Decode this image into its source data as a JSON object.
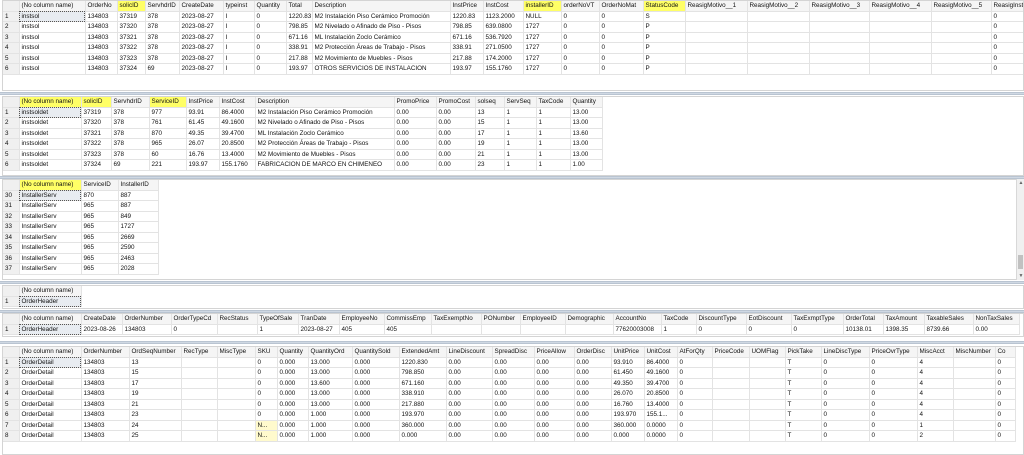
{
  "grids": [
    {
      "id": "g1",
      "columns": [
        {
          "label": "",
          "w": 16
        },
        {
          "label": "(No column name)",
          "w": 66
        },
        {
          "label": "OrderNo",
          "w": 32
        },
        {
          "label": "solicID",
          "w": 28,
          "highlight": true
        },
        {
          "label": "ServhdrID",
          "w": 34
        },
        {
          "label": "CreateDate",
          "w": 44
        },
        {
          "label": "typeinst",
          "w": 31
        },
        {
          "label": "Quantity",
          "w": 32
        },
        {
          "label": "Total",
          "w": 26
        },
        {
          "label": "Description",
          "w": 138
        },
        {
          "label": "InstPrice",
          "w": 33
        },
        {
          "label": "InstCost",
          "w": 40
        },
        {
          "label": "installerID",
          "w": 38,
          "highlight": true
        },
        {
          "label": "orderNoVT",
          "w": 38
        },
        {
          "label": "OrderNoMat",
          "w": 44
        },
        {
          "label": "StatusCode",
          "w": 42,
          "highlight": true
        },
        {
          "label": "ReasigMotivo__1",
          "w": 62
        },
        {
          "label": "ReasigMotivo__2",
          "w": 62
        },
        {
          "label": "ReasigMotivo__3",
          "w": 60
        },
        {
          "label": "ReasigMotivo__4",
          "w": 62
        },
        {
          "label": "ReasigMotivo__5",
          "w": 60
        },
        {
          "label": "ReasigInstal",
          "w": 40
        }
      ],
      "rows": [
        [
          "1",
          "instsol",
          "134803",
          "37319",
          "378",
          "2023-08-27",
          "I",
          "0",
          "1220.83",
          "M2 Instalación Piso Cerámico Promoción",
          "1220.83",
          "1123.2000",
          "NULL",
          "0",
          "0",
          "S",
          "",
          "",
          "",
          "",
          "",
          "0"
        ],
        [
          "2",
          "instsol",
          "134803",
          "37320",
          "378",
          "2023-08-27",
          "I",
          "0",
          "798.85",
          "M2 Nivelado o Afinado de Piso - Pisos",
          "798.85",
          "639.0800",
          "1727",
          "0",
          "0",
          "P",
          "",
          "",
          "",
          "",
          "",
          "0"
        ],
        [
          "3",
          "instsol",
          "134803",
          "37321",
          "378",
          "2023-08-27",
          "I",
          "0",
          "671.16",
          "ML Instalación Zoclo Cerámico",
          "671.16",
          "536.7920",
          "1727",
          "0",
          "0",
          "P",
          "",
          "",
          "",
          "",
          "",
          "0"
        ],
        [
          "4",
          "instsol",
          "134803",
          "37322",
          "378",
          "2023-08-27",
          "I",
          "0",
          "338.91",
          "M2 Protección Áreas de Trabajo - Pisos",
          "338.91",
          "271.0500",
          "1727",
          "0",
          "0",
          "P",
          "",
          "",
          "",
          "",
          "",
          "0"
        ],
        [
          "5",
          "instsol",
          "134803",
          "37323",
          "378",
          "2023-08-27",
          "I",
          "0",
          "217.88",
          "M2 Movimiento de Muebles - Pisos",
          "217.88",
          "174.2000",
          "1727",
          "0",
          "0",
          "P",
          "",
          "",
          "",
          "",
          "",
          "0"
        ],
        [
          "6",
          "instsol",
          "134803",
          "37324",
          "69",
          "2023-08-27",
          "I",
          "0",
          "193.97",
          "OTROS SERVICIOS DE INSTALACION",
          "193.97",
          "155.1760",
          "1727",
          "0",
          "0",
          "P",
          "",
          "",
          "",
          "",
          "",
          "0"
        ]
      ]
    },
    {
      "id": "g2",
      "columns": [
        {
          "label": "",
          "w": 16
        },
        {
          "label": "(No column name)",
          "w": 62,
          "highlight": true
        },
        {
          "label": "solicID",
          "w": 30,
          "highlight": true
        },
        {
          "label": "ServhdrID",
          "w": 38
        },
        {
          "label": "ServiceID",
          "w": 37,
          "highlight": true
        },
        {
          "label": "InstPrice",
          "w": 33
        },
        {
          "label": "InstCost",
          "w": 36
        },
        {
          "label": "Description",
          "w": 139
        },
        {
          "label": "PromoPrice",
          "w": 42
        },
        {
          "label": "PromoCost",
          "w": 39
        },
        {
          "label": "solseq",
          "w": 29
        },
        {
          "label": "ServSeq",
          "w": 32
        },
        {
          "label": "TaxCode",
          "w": 34
        },
        {
          "label": "Quantity",
          "w": 32
        }
      ],
      "rows": [
        [
          "1",
          "instsoldet",
          "37319",
          "378",
          "977",
          "93.91",
          "86.4000",
          "M2 Instalación Piso Cerámico Promoción",
          "0.00",
          "0.00",
          "13",
          "1",
          "1",
          "13.00"
        ],
        [
          "2",
          "instsoldet",
          "37320",
          "378",
          "761",
          "61.45",
          "49.1600",
          "M2 Nivelado o Afinado de Piso - Pisos",
          "0.00",
          "0.00",
          "15",
          "1",
          "1",
          "13.00"
        ],
        [
          "3",
          "instsoldet",
          "37321",
          "378",
          "870",
          "49.35",
          "39.4700",
          "ML Instalación Zoclo Cerámico",
          "0.00",
          "0.00",
          "17",
          "1",
          "1",
          "13.60"
        ],
        [
          "4",
          "instsoldet",
          "37322",
          "378",
          "965",
          "26.07",
          "20.8500",
          "M2 Protección Áreas de Trabajo - Pisos",
          "0.00",
          "0.00",
          "19",
          "1",
          "1",
          "13.00"
        ],
        [
          "5",
          "instsoldet",
          "37323",
          "378",
          "60",
          "16.76",
          "13.4000",
          "M2 Movimiento de Muebles - Pisos",
          "0.00",
          "0.00",
          "21",
          "1",
          "1",
          "13.00"
        ],
        [
          "6",
          "instsoldet",
          "37324",
          "69",
          "221",
          "193.97",
          "155.1760",
          "FABRICACION DE MARCO  EN CHIMENEO",
          "0.00",
          "0.00",
          "23",
          "1",
          "1",
          "1.00"
        ]
      ]
    },
    {
      "id": "g3",
      "columns": [
        {
          "label": "",
          "w": 16
        },
        {
          "label": "(No column name)",
          "w": 62,
          "highlight": true
        },
        {
          "label": "ServiceID",
          "w": 37
        },
        {
          "label": "InstallerID",
          "w": 40
        }
      ],
      "rows": [
        [
          "30",
          "InstallerServ",
          "870",
          "887"
        ],
        [
          "31",
          "InstallerServ",
          "965",
          "887"
        ],
        [
          "32",
          "InstallerServ",
          "965",
          "849"
        ],
        [
          "33",
          "InstallerServ",
          "965",
          "1727"
        ],
        [
          "34",
          "InstallerServ",
          "965",
          "2669"
        ],
        [
          "35",
          "InstallerServ",
          "965",
          "2590"
        ],
        [
          "36",
          "InstallerServ",
          "965",
          "2463"
        ],
        [
          "37",
          "InstallerServ",
          "965",
          "2028"
        ]
      ]
    },
    {
      "id": "g4",
      "columns": [
        {
          "label": "",
          "w": 16
        },
        {
          "label": "(No column name)",
          "w": 62
        }
      ],
      "rows": [
        [
          "1",
          "OrderHeader"
        ]
      ]
    },
    {
      "id": "g5",
      "columns": [
        {
          "label": "",
          "w": 16
        },
        {
          "label": "(No column name)",
          "w": 62
        },
        {
          "label": "CreateDate",
          "w": 41
        },
        {
          "label": "OrderNumber",
          "w": 49
        },
        {
          "label": "OrderTypeCd",
          "w": 46
        },
        {
          "label": "RecStatus",
          "w": 40
        },
        {
          "label": "TypeOfSale",
          "w": 41
        },
        {
          "label": "TranDate",
          "w": 41
        },
        {
          "label": "EmployeeNo",
          "w": 45
        },
        {
          "label": "CommissEmp",
          "w": 47
        },
        {
          "label": "TaxExemptNo",
          "w": 50
        },
        {
          "label": "PONumber",
          "w": 39
        },
        {
          "label": "EmployeeID",
          "w": 45
        },
        {
          "label": "Demographic",
          "w": 48
        },
        {
          "label": "AccountNo",
          "w": 48
        },
        {
          "label": "TaxCode",
          "w": 35
        },
        {
          "label": "DiscountType",
          "w": 50
        },
        {
          "label": "EotDiscount",
          "w": 45
        },
        {
          "label": "TaxExmptType",
          "w": 52
        },
        {
          "label": "OrderTotal",
          "w": 40
        },
        {
          "label": "TaxAmount",
          "w": 41
        },
        {
          "label": "TaxableSales",
          "w": 49
        },
        {
          "label": "NonTaxSales",
          "w": 46
        }
      ],
      "rows": [
        [
          "1",
          "OrderHeader",
          "2023-08-26",
          "134803",
          "0",
          "",
          "1",
          "2023-08-27",
          "405",
          "405",
          "",
          "",
          "",
          "",
          "77620003008",
          "1",
          "0",
          "0",
          "0",
          "10138.01",
          "1398.35",
          "8739.66",
          "0.00"
        ]
      ]
    },
    {
      "id": "g6",
      "columns": [
        {
          "label": "",
          "w": 16
        },
        {
          "label": "(No column name)",
          "w": 62
        },
        {
          "label": "OrderNumber",
          "w": 48
        },
        {
          "label": "OrdSeqNumber",
          "w": 52
        },
        {
          "label": "RecType",
          "w": 36
        },
        {
          "label": "MiscType",
          "w": 38
        },
        {
          "label": "SKU",
          "w": 22
        },
        {
          "label": "Quantity",
          "w": 31
        },
        {
          "label": "QuantityOrd",
          "w": 44
        },
        {
          "label": "QuantitySold",
          "w": 47
        },
        {
          "label": "ExtendedAmt",
          "w": 47
        },
        {
          "label": "LineDiscount",
          "w": 46
        },
        {
          "label": "SpreadDisc",
          "w": 42
        },
        {
          "label": "PriceAllow",
          "w": 40
        },
        {
          "label": "OrderDisc",
          "w": 37
        },
        {
          "label": "UnitPrice",
          "w": 33
        },
        {
          "label": "UnitCost",
          "w": 33
        },
        {
          "label": "AtForQty",
          "w": 35
        },
        {
          "label": "PriceCode",
          "w": 37
        },
        {
          "label": "UOMFlag",
          "w": 36
        },
        {
          "label": "PickTake",
          "w": 36
        },
        {
          "label": "LineDiscType",
          "w": 48
        },
        {
          "label": "PriceOvrType",
          "w": 48
        },
        {
          "label": "MiscAcct",
          "w": 36
        },
        {
          "label": "MiscNumber",
          "w": 42
        },
        {
          "label": "Co",
          "w": 20
        }
      ],
      "rows": [
        [
          "1",
          "OrderDetail",
          "134803",
          "13",
          "",
          "",
          "0",
          "0.000",
          "13.000",
          "0.000",
          "1220.830",
          "0.00",
          "0.00",
          "0.00",
          "0.00",
          "93.910",
          "86.4000",
          "0",
          "",
          "",
          "T",
          "0",
          "0",
          "4",
          "",
          "0"
        ],
        [
          "2",
          "OrderDetail",
          "134803",
          "15",
          "",
          "",
          "0",
          "0.000",
          "13.000",
          "0.000",
          "798.850",
          "0.00",
          "0.00",
          "0.00",
          "0.00",
          "61.450",
          "49.1600",
          "0",
          "",
          "",
          "T",
          "0",
          "0",
          "4",
          "",
          "0"
        ],
        [
          "3",
          "OrderDetail",
          "134803",
          "17",
          "",
          "",
          "0",
          "0.000",
          "13.600",
          "0.000",
          "671.160",
          "0.00",
          "0.00",
          "0.00",
          "0.00",
          "49.350",
          "39.4700",
          "0",
          "",
          "",
          "T",
          "0",
          "0",
          "4",
          "",
          "0"
        ],
        [
          "4",
          "OrderDetail",
          "134803",
          "19",
          "",
          "",
          "0",
          "0.000",
          "13.000",
          "0.000",
          "338.910",
          "0.00",
          "0.00",
          "0.00",
          "0.00",
          "26.070",
          "20.8500",
          "0",
          "",
          "",
          "T",
          "0",
          "0",
          "4",
          "",
          "0"
        ],
        [
          "5",
          "OrderDetail",
          "134803",
          "21",
          "",
          "",
          "0",
          "0.000",
          "13.000",
          "0.000",
          "217.880",
          "0.00",
          "0.00",
          "0.00",
          "0.00",
          "16.760",
          "13.4000",
          "0",
          "",
          "",
          "T",
          "0",
          "0",
          "4",
          "",
          "0"
        ],
        [
          "6",
          "OrderDetail",
          "134803",
          "23",
          "",
          "",
          "0",
          "0.000",
          "1.000",
          "0.000",
          "193.970",
          "0.00",
          "0.00",
          "0.00",
          "0.00",
          "193.970",
          "155.1...",
          "0",
          "",
          "",
          "T",
          "0",
          "0",
          "4",
          "",
          "0"
        ],
        [
          "7",
          "OrderDetail",
          "134803",
          "24",
          "",
          "",
          "N...",
          "0.000",
          "1.000",
          "0.000",
          "360.000",
          "0.00",
          "0.00",
          "0.00",
          "0.00",
          "360.000",
          "0.0000",
          "0",
          "",
          "",
          "T",
          "0",
          "0",
          "1",
          "",
          "0"
        ],
        [
          "8",
          "OrderDetail",
          "134803",
          "25",
          "",
          "",
          "N...",
          "0.000",
          "1.000",
          "0.000",
          "0.000",
          "0.00",
          "0.00",
          "0.00",
          "0.00",
          "0.000",
          "0.0000",
          "0",
          "",
          "",
          "T",
          "0",
          "0",
          "2",
          "",
          "0"
        ]
      ]
    }
  ]
}
